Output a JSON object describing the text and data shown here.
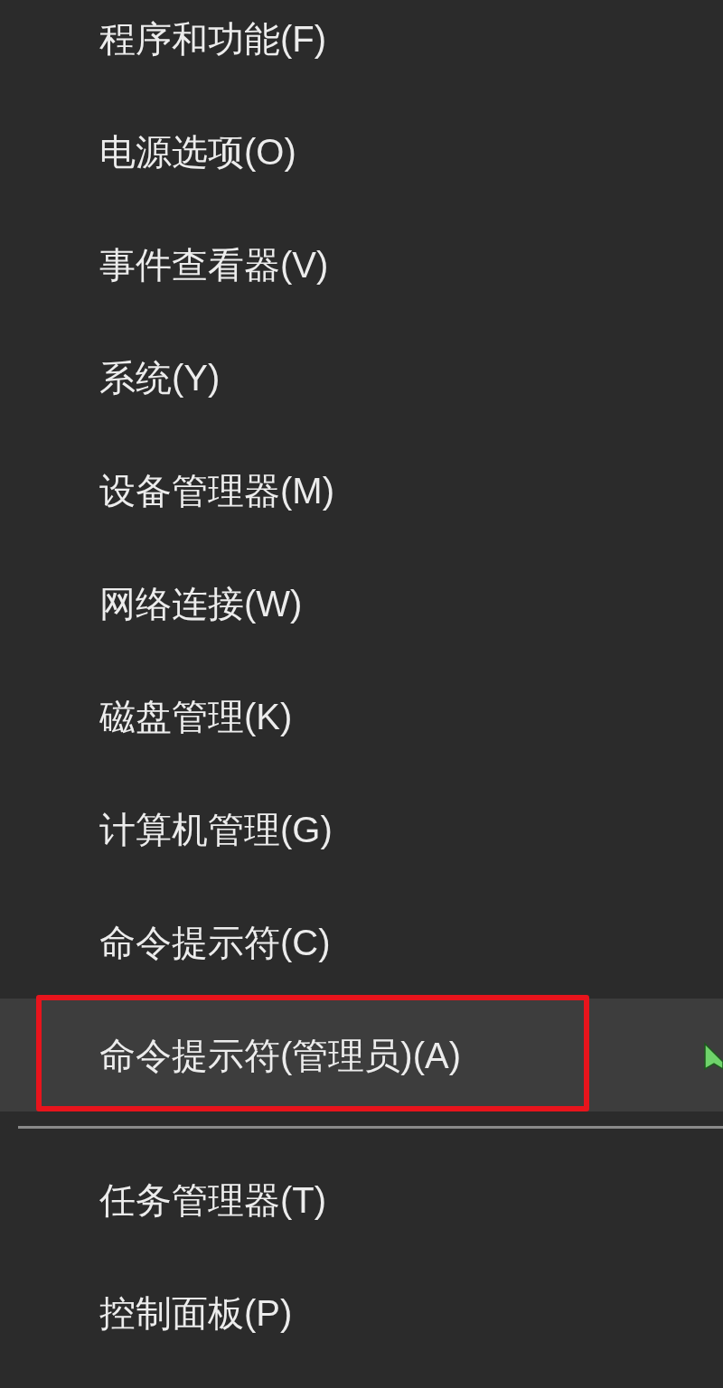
{
  "menu": {
    "items": [
      {
        "kind": "item",
        "label": "程序和功能(F)",
        "selected": false,
        "marked": false
      },
      {
        "kind": "item",
        "label": "电源选项(O)",
        "selected": false,
        "marked": false
      },
      {
        "kind": "item",
        "label": "事件查看器(V)",
        "selected": false,
        "marked": false
      },
      {
        "kind": "item",
        "label": "系统(Y)",
        "selected": false,
        "marked": false
      },
      {
        "kind": "item",
        "label": "设备管理器(M)",
        "selected": false,
        "marked": false
      },
      {
        "kind": "item",
        "label": "网络连接(W)",
        "selected": false,
        "marked": false
      },
      {
        "kind": "item",
        "label": "磁盘管理(K)",
        "selected": false,
        "marked": false
      },
      {
        "kind": "item",
        "label": "计算机管理(G)",
        "selected": false,
        "marked": false
      },
      {
        "kind": "item",
        "label": "命令提示符(C)",
        "selected": false,
        "marked": false
      },
      {
        "kind": "item",
        "label": "命令提示符(管理员)(A)",
        "selected": true,
        "marked": true
      },
      {
        "kind": "separator"
      },
      {
        "kind": "item",
        "label": "任务管理器(T)",
        "selected": false,
        "marked": false
      },
      {
        "kind": "item",
        "label": "控制面板(P)",
        "selected": false,
        "marked": false
      }
    ]
  }
}
